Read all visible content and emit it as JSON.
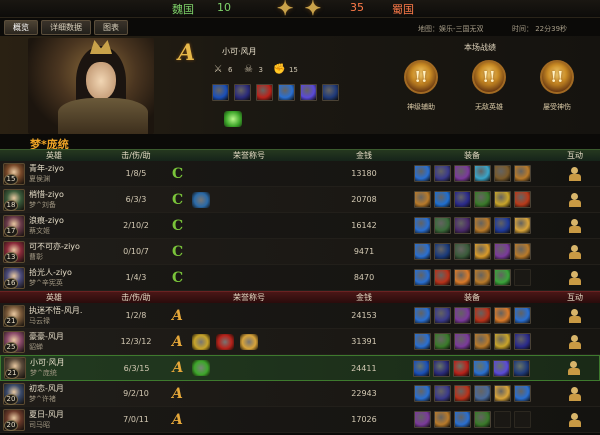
{
  "top": {
    "team_left": "魏国",
    "score_left": "10",
    "score_right": "35",
    "team_right": "蜀国"
  },
  "tabs": [
    "概览",
    "详细数据",
    "图表"
  ],
  "map": "地图：娱乐-三国无双",
  "time": "时间：   22分39秒",
  "featured": {
    "grade": "A",
    "name": "小可·风月",
    "stats": [
      {
        "icon": "swords-icon",
        "value": "6"
      },
      {
        "icon": "skull-icon",
        "value": "3"
      },
      {
        "icon": "fist-icon",
        "value": "15"
      }
    ],
    "items": [
      "#1a4fb8",
      "#2a2a7a",
      "#b8221a",
      "#2a6fd0",
      "#5a4ad8",
      "#1f3a7a"
    ],
    "buff": "#3da62a"
  },
  "battle": {
    "title": "本场战绩",
    "badges": [
      {
        "label": "神级辅助",
        "mark": "!!"
      },
      {
        "label": "无敌英雄",
        "mark": "!!"
      },
      {
        "label": "屡受神伤",
        "mark": "!!"
      }
    ]
  },
  "team_name": "梦*庞统",
  "headers": {
    "hero": "英雄",
    "kda": "击/伤/助",
    "title": "荣誉称号",
    "gold": "金钱",
    "equip": "装备",
    "act": "互动"
  },
  "team_a": [
    {
      "player": "青年-ziyo",
      "hero": "夏侯渊",
      "level": "15",
      "kda": "1/8/5",
      "grade": "C",
      "honors": [],
      "gold": "13180",
      "avatar": "#7a4a2a",
      "items": [
        "#2a6fd0",
        "#3a3a8a",
        "#7a3a9a",
        "#3aa4c8",
        "#7a5a2a",
        "#b87a2a"
      ]
    },
    {
      "player": "梢惜-ziyo",
      "hero": "梦^刘备",
      "level": "18",
      "kda": "6/3/3",
      "grade": "C",
      "honors": [
        "#2a6aa8"
      ],
      "gold": "20708",
      "avatar": "#3a5a3a",
      "items": [
        "#b87a2a",
        "#1f6fd0",
        "#2a2a8a",
        "#3a7a2a",
        "#c8a42a",
        "#b83a1a"
      ]
    },
    {
      "player": "浪痕-ziyo",
      "hero": "蔡文姬",
      "level": "17",
      "kda": "2/10/2",
      "grade": "C",
      "honors": [],
      "gold": "16142",
      "avatar": "#6a3a4a",
      "items": [
        "#2a6fd0",
        "#3a6a3a",
        "#4a2a6a",
        "#b87a2a",
        "#1f3a9a",
        "#d8a43a"
      ]
    },
    {
      "player": "可不可亦-ziyo",
      "hero": "曹彰",
      "level": "13",
      "kda": "0/10/7",
      "grade": "C",
      "honors": [],
      "gold": "9471",
      "avatar": "#8a2a3a",
      "items": [
        "#2a6fd0",
        "#1a3a7a",
        "#3a5a3a",
        "#d89a2a",
        "#7a3a9a",
        "#b87a2a"
      ]
    },
    {
      "player": "拾光人-ziyo",
      "hero": "梦^辛宪英",
      "level": "16",
      "kda": "1/4/3",
      "grade": "C",
      "honors": [],
      "gold": "8470",
      "avatar": "#4a4a7a",
      "items": [
        "#2a6fd0",
        "#b8321a",
        "#d87a2a",
        "#b87a2a",
        "#3aa43a",
        "empty"
      ]
    }
  ],
  "team_b": [
    {
      "player": "执迷不悟-风月.",
      "hero": "马云禄",
      "level": "21",
      "kda": "1/2/8",
      "grade": "A",
      "honors": [],
      "gold": "24153",
      "avatar": "#7a5a3a",
      "items": [
        "#2a6fd0",
        "#3a3a8a",
        "#7a3a9a",
        "#b8321a",
        "#d87a2a",
        "#2a6fd0"
      ]
    },
    {
      "player": "豪豪-风月",
      "hero": "貂蝉",
      "level": "25",
      "kda": "12/3/12",
      "grade": "A",
      "honors": [
        "#c8a42a",
        "#b8221a",
        "#d8a43a"
      ],
      "gold": "31391",
      "avatar": "#8a4a6a",
      "items": [
        "#2a6fd0",
        "#3a7a2a",
        "#7a3a9a",
        "#b87a2a",
        "#c8a42a",
        "#2a2a8a"
      ]
    },
    {
      "player": "小可·风月",
      "hero": "梦^庞统",
      "level": "21",
      "kda": "6/3/15",
      "grade": "A",
      "honors": [
        "#3da62a"
      ],
      "gold": "24411",
      "avatar": "#5a4a3a",
      "items": [
        "#1a4fb8",
        "#2a2a7a",
        "#b8221a",
        "#2a6fd0",
        "#5a4ad8",
        "#1f3a7a"
      ]
    },
    {
      "player": "初恋-风月",
      "hero": "梦^许褚",
      "level": "20",
      "kda": "9/2/10",
      "grade": "A",
      "honors": [],
      "gold": "22943",
      "avatar": "#3a4a6a",
      "items": [
        "#2a6fd0",
        "#3a3a8a",
        "#b8321a",
        "#4a6a9a",
        "#d8a43a",
        "#2a6fd0"
      ]
    },
    {
      "player": "夏日-风月",
      "hero": "司马昭",
      "level": "20",
      "kda": "7/0/11",
      "grade": "A",
      "honors": [],
      "gold": "17026",
      "avatar": "#6a3a2a",
      "items": [
        "#7a3a9a",
        "#b87a2a",
        "#2a6fd0",
        "#3a7a2a",
        "empty",
        "empty"
      ]
    }
  ]
}
